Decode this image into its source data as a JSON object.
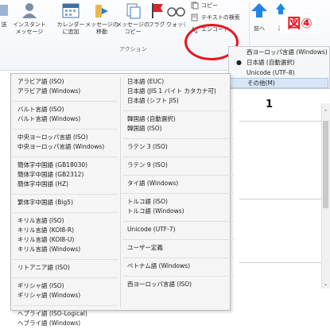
{
  "ribbon": {
    "buttons": [
      {
        "id": "send",
        "label": "送"
      },
      {
        "id": "im",
        "label": "インスタント\nメッセージ"
      },
      {
        "id": "calendar",
        "label": "カレンダー\nに追加"
      },
      {
        "id": "move",
        "label": "メッセージの\n移動"
      },
      {
        "id": "copy",
        "label": "メッセージの\nコピー"
      },
      {
        "id": "flag",
        "label": "フラグ"
      },
      {
        "id": "watch",
        "label": "ウォッチ"
      },
      {
        "id": "prev",
        "label": "前へ"
      },
      {
        "id": "next",
        "label": "次"
      }
    ],
    "copy_small": "コピー",
    "text_search": "テキストの検索",
    "encode": "エンコード",
    "group_action": "アクション",
    "callout": "図④"
  },
  "parent_menu": {
    "items": [
      {
        "label": "西ヨーロッパ言語 (Windows)",
        "checked": false
      },
      {
        "label": "日本語 (自動選択)",
        "checked": true
      },
      {
        "label": "Unicode (UTF-8)",
        "checked": false
      },
      {
        "label": "その他(M)",
        "checked": false,
        "highlighted": true
      }
    ]
  },
  "document": {
    "title": "1"
  },
  "submenu": {
    "left_groups": [
      [
        "アラビア語 (ISO)",
        "アラビア語 (Windows)"
      ],
      [
        "バルト言語 (ISO)",
        "バルト言語 (Windows)"
      ],
      [
        "中央ヨーロッパ言語 (ISO)",
        "中央ヨーロッパ言語 (Windows)"
      ],
      [
        "簡体字中国語 (GB18030)",
        "簡体字中国語 (GB2312)",
        "簡体字中国語 (HZ)"
      ],
      [
        "繁体字中国語 (Big5)"
      ],
      [
        "キリル言語 (ISO)",
        "キリル言語 (KOI8-R)",
        "キリル言語 (KOI8-U)",
        "キリル言語 (Windows)"
      ],
      [
        "リトアニア語 (ISO)"
      ],
      [
        "ギリシャ語 (ISO)",
        "ギリシャ語 (Windows)"
      ],
      [
        "ヘブライ語 (ISO-Logical)",
        "ヘブライ語 (Windows)"
      ]
    ],
    "right_groups": [
      [
        "日本語 (EUC)",
        "日本語 (JIS 1 バイト カタカナ可)",
        "日本語 (シフト JIS)"
      ],
      [
        "韓国語 (自動選択)",
        "韓国語 (ISO)"
      ],
      [
        "ラテン 3 (ISO)"
      ],
      [
        "ラテン 9 (ISO)"
      ],
      [
        "タイ語 (Windows)"
      ],
      [
        "トルコ語 (ISO)",
        "トルコ語 (Windows)"
      ],
      [
        "Unicode (UTF-7)"
      ],
      [
        "ユーザー定義"
      ],
      [
        "ベトナム語 (Windows)"
      ],
      [
        "西ヨーロッパ言語 (ISO)"
      ]
    ]
  }
}
